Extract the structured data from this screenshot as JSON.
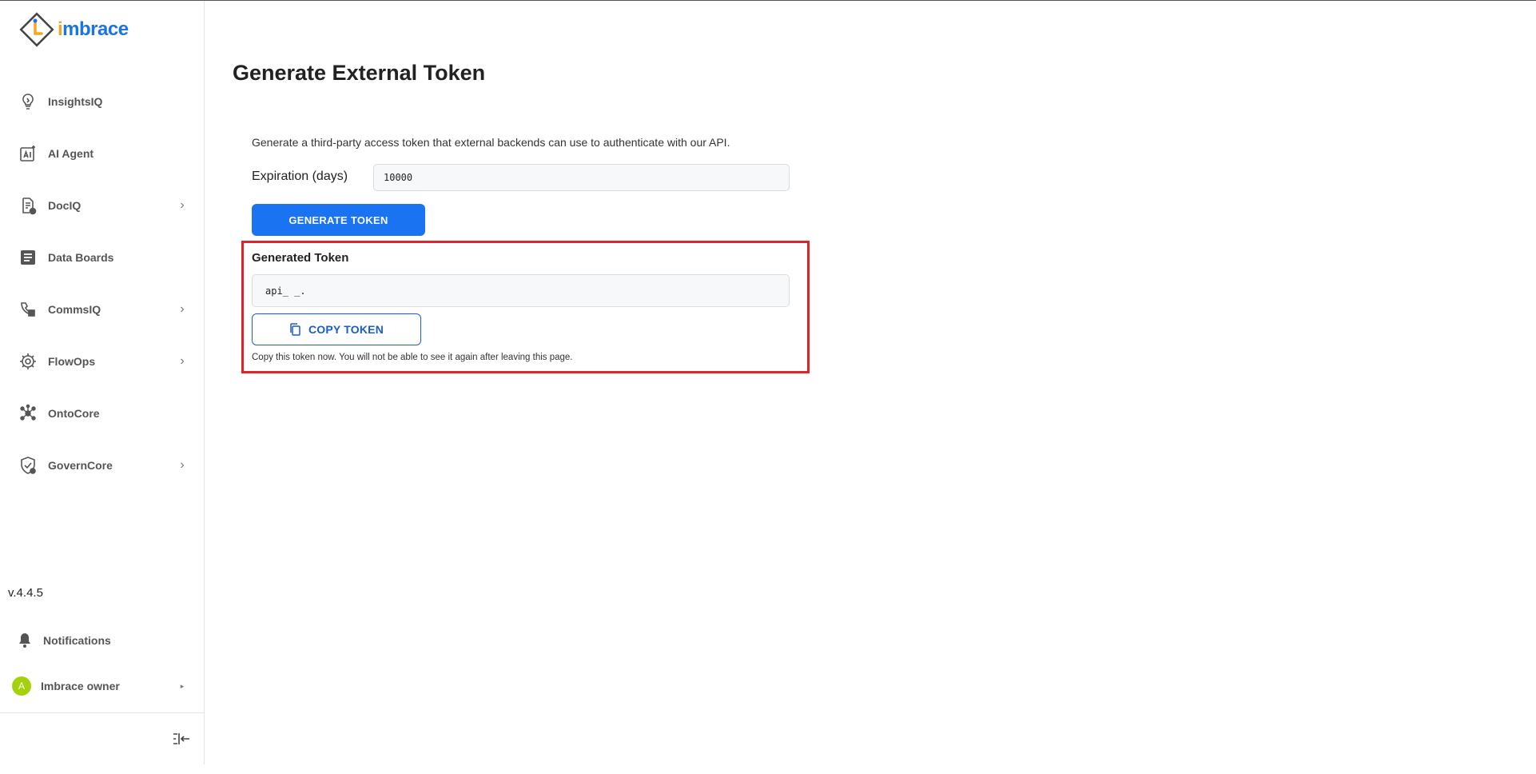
{
  "brand": {
    "name_prefix": "i",
    "name_rest": "mbrace"
  },
  "sidebar": {
    "items": [
      {
        "label": "InsightsIQ",
        "icon": "insights-bulb-icon",
        "has_submenu": false
      },
      {
        "label": "AI Agent",
        "icon": "ai-agent-icon",
        "has_submenu": false
      },
      {
        "label": "DocIQ",
        "icon": "document-icon",
        "has_submenu": true
      },
      {
        "label": "Data Boards",
        "icon": "data-board-icon",
        "has_submenu": false
      },
      {
        "label": "CommsIQ",
        "icon": "comms-icon",
        "has_submenu": true
      },
      {
        "label": "FlowOps",
        "icon": "flow-gear-icon",
        "has_submenu": true
      },
      {
        "label": "OntoCore",
        "icon": "network-icon",
        "has_submenu": false
      },
      {
        "label": "GovernCore",
        "icon": "shield-check-icon",
        "has_submenu": true
      }
    ],
    "version": "v.4.4.5",
    "notifications_label": "Notifications",
    "user": {
      "initial": "A",
      "name": "Imbrace owner"
    }
  },
  "main": {
    "title": "Generate External Token",
    "description": "Generate a third-party access token that external backends can use to authenticate with our API.",
    "expiration_label": "Expiration (days)",
    "expiration_value": "10000",
    "generate_button": "GENERATE TOKEN",
    "generated_title": "Generated Token",
    "token_value": "api_                    _.",
    "copy_button": "COPY TOKEN",
    "copy_note": "Copy this token now. You will not be able to see it again after leaving this page."
  },
  "colors": {
    "primary": "#1a73f0",
    "highlight_border": "#e0222d",
    "brand_orange": "#f5a623",
    "avatar": "#a3d10b"
  }
}
